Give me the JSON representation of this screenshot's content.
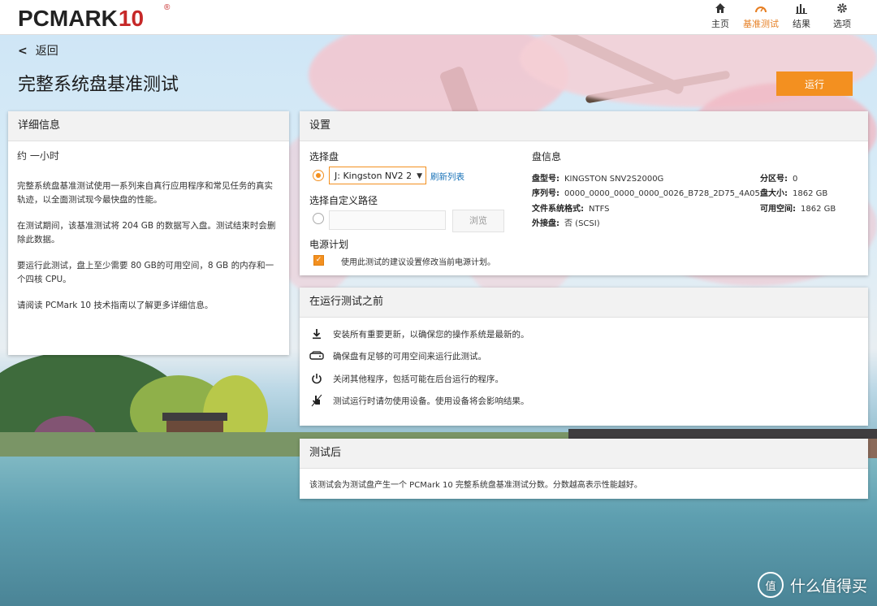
{
  "app": {
    "logo_main": "PCMARK",
    "logo_num": "10",
    "logo_reg": "®"
  },
  "nav": [
    {
      "label": "主页",
      "icon": "home-icon"
    },
    {
      "label": "基准测试",
      "icon": "gauge-icon",
      "active": true
    },
    {
      "label": "结果",
      "icon": "bar-chart-icon"
    },
    {
      "label": "选项",
      "icon": "gear-icon"
    }
  ],
  "header": {
    "back_label": "返回",
    "title": "完整系统盘基准测试",
    "run_label": "运行"
  },
  "detail": {
    "heading": "详细信息",
    "duration": "约 一小时",
    "para1": "完整系统盘基准测试使用一系列来自真行应用程序和常见任务的真实轨迹，以全面测试现今最快盘的性能。",
    "para2": "在测试期间，该基准测试将 204 GB 的数据写入盘。测试结束时会删除此数据。",
    "para3": "要运行此测试，盘上至少需要 80 GB的可用空间，8 GB 的内存和一个四核 CPU。",
    "para4": "请阅读 PCMark 10 技术指南以了解更多详细信息。"
  },
  "settings": {
    "heading": "设置",
    "select_drive_label": "选择盘",
    "drive_value": "J: Kingston NV2 2",
    "refresh_label": "刷新列表",
    "custom_path_label": "选择自定义路径",
    "custom_path_value": "",
    "browse_label": "浏览",
    "power_plan_label": "电源计划",
    "power_plan_option": "使用此测试的建议设置修改当前电源计划。",
    "disk_info_heading": "盘信息",
    "disk_info": {
      "model_key": "盘型号:",
      "model_val": "KINGSTON SNV2S2000G",
      "serial_key": "序列号:",
      "serial_val": "0000_0000_0000_0000_0026_B728_2D75_4A05.",
      "fs_key": "文件系统格式:",
      "fs_val": "NTFS",
      "external_key": "外接盘:",
      "external_val": "否 (SCSI)",
      "partition_key": "分区号:",
      "partition_val": "0",
      "size_key": "盘大小:",
      "size_val": "1862 GB",
      "free_key": "可用空间:",
      "free_val": "1862 GB"
    }
  },
  "before": {
    "heading": "在运行测试之前",
    "tips": [
      {
        "icon": "download-icon",
        "text": "安装所有重要更新，以确保您的操作系统是最新的。"
      },
      {
        "icon": "drive-icon",
        "text": "确保盘有足够的可用空间来运行此测试。"
      },
      {
        "icon": "power-icon",
        "text": "关闭其他程序，包括可能在后台运行的程序。"
      },
      {
        "icon": "no-touch-icon",
        "text": "测试运行时请勿使用设备。使用设备将会影响结果。"
      }
    ]
  },
  "after": {
    "heading": "测试后",
    "text": "该测试会为测试盘产生一个 PCMark 10 完整系统盘基准测试分数。分数越高表示性能越好。"
  },
  "watermark": {
    "badge": "值",
    "text": "什么值得买"
  }
}
